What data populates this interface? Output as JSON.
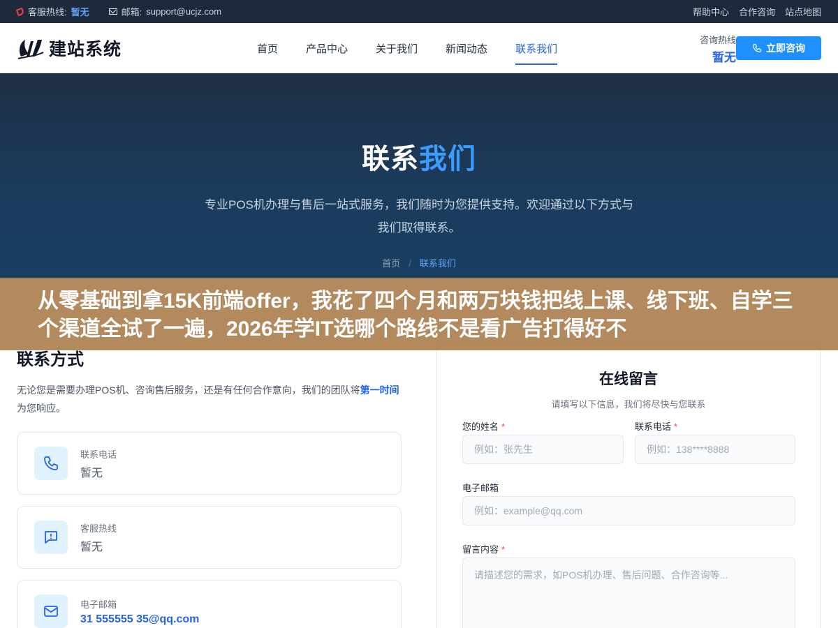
{
  "topbar": {
    "hotline_label": "客服热线:",
    "hotline_value": "暂无",
    "email_label": "邮箱:",
    "email_value": "support@ucjz.com",
    "links": [
      "帮助中心",
      "合作咨询",
      "站点地图"
    ]
  },
  "header": {
    "logo_text": "建站系统",
    "nav": [
      "首页",
      "产品中心",
      "关于我们",
      "新闻动态",
      "联系我们"
    ],
    "active_nav_index": 4,
    "consult_label": "咨询热线",
    "consult_value": "暂无",
    "cta_label": "立即咨询"
  },
  "hero": {
    "title_plain": "联系",
    "title_accent": "我们",
    "subtitle": "专业POS机办理与售后一站式服务，我们随时为您提供支持。欢迎通过以下方式与我们取得联系。",
    "breadcrumb_home": "首页",
    "breadcrumb_sep": "/",
    "breadcrumb_current": "联系我们"
  },
  "overlay": {
    "text": "从零基础到拿15K前端offer，我花了四个月和两万块钱把线上课、线下班、自学三个渠道全试了一遍，2026年学IT选哪个路线不是看广告打得好不"
  },
  "contact": {
    "title": "联系方式",
    "desc_before": "无论您是需要办理POS机、咨询售后服务，还是有任何合作意向，我们的团队将",
    "desc_highlight": "第一时间",
    "desc_after": "为您响应。",
    "cards": [
      {
        "label": "联系电话",
        "value": "暂无",
        "icon": "phone-icon"
      },
      {
        "label": "客服热线",
        "value": "暂无",
        "icon": "message-icon"
      },
      {
        "label": "电子邮箱",
        "value": "31 555555 35@qq.com",
        "icon": "mail-icon"
      }
    ]
  },
  "form": {
    "title": "在线留言",
    "subtitle": "请填写以下信息，我们将尽快与您联系",
    "name_label": "您的姓名",
    "name_placeholder": "例如：张先生",
    "phone_label": "联系电话",
    "phone_placeholder": "例如：138****8888",
    "email_label": "电子邮箱",
    "email_placeholder": "例如：example@qq.com",
    "message_label": "留言内容",
    "message_placeholder": "请描述您的需求，如POS机办理、售后问题、合作咨询等...",
    "required_mark": "*"
  },
  "colors": {
    "accent": "#2563eb",
    "cta": "#1e90ff",
    "topbar": "#1e293b",
    "hero": "#1b3b5c",
    "overlay": "#ac8050"
  }
}
